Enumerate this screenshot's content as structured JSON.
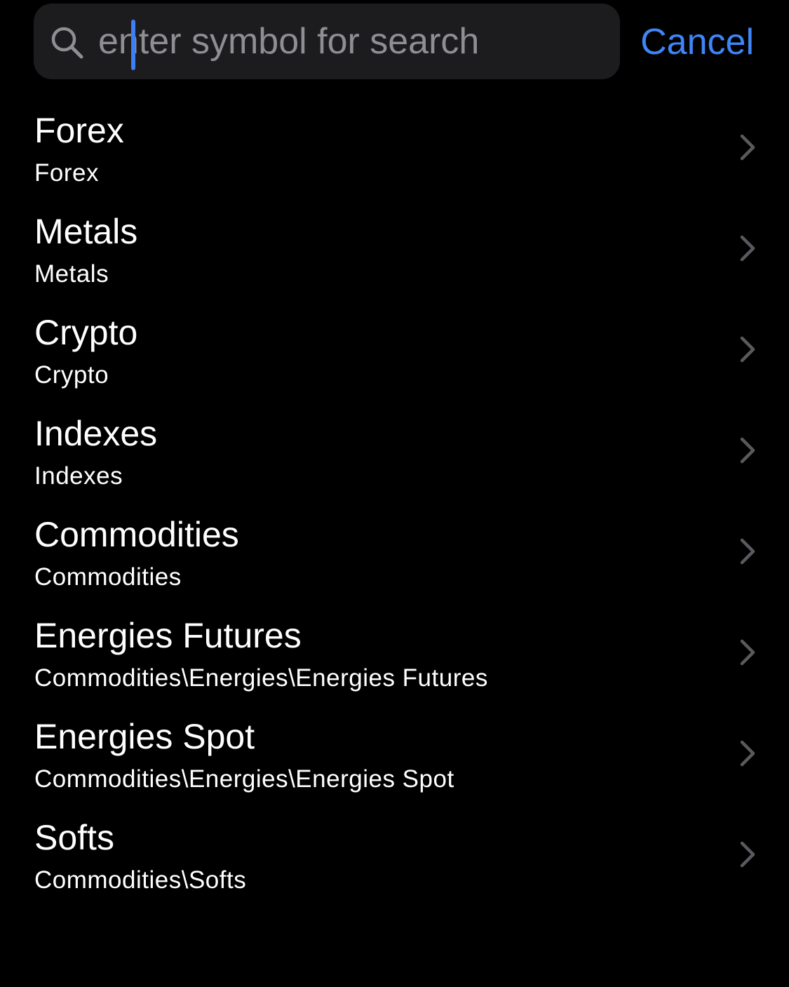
{
  "search": {
    "placeholder": "enter symbol for search",
    "value": "",
    "cancel_label": "Cancel"
  },
  "colors": {
    "background": "#000000",
    "search_field": "#1c1c1e",
    "accent": "#3f85f7",
    "placeholder": "#8e8e93",
    "chevron": "#5a5a5e"
  },
  "categories": [
    {
      "title": "Forex",
      "path": "Forex",
      "icon": "chevron-right-icon"
    },
    {
      "title": "Metals",
      "path": "Metals",
      "icon": "chevron-right-icon"
    },
    {
      "title": "Crypto",
      "path": "Crypto",
      "icon": "chevron-right-icon"
    },
    {
      "title": "Indexes",
      "path": "Indexes",
      "icon": "chevron-right-icon"
    },
    {
      "title": "Commodities",
      "path": "Commodities",
      "icon": "chevron-right-icon"
    },
    {
      "title": "Energies Futures",
      "path": "Commodities\\Energies\\Energies Futures",
      "icon": "chevron-right-icon"
    },
    {
      "title": "Energies Spot",
      "path": "Commodities\\Energies\\Energies Spot",
      "icon": "chevron-right-icon"
    },
    {
      "title": "Softs",
      "path": "Commodities\\Softs",
      "icon": "chevron-right-icon"
    }
  ]
}
